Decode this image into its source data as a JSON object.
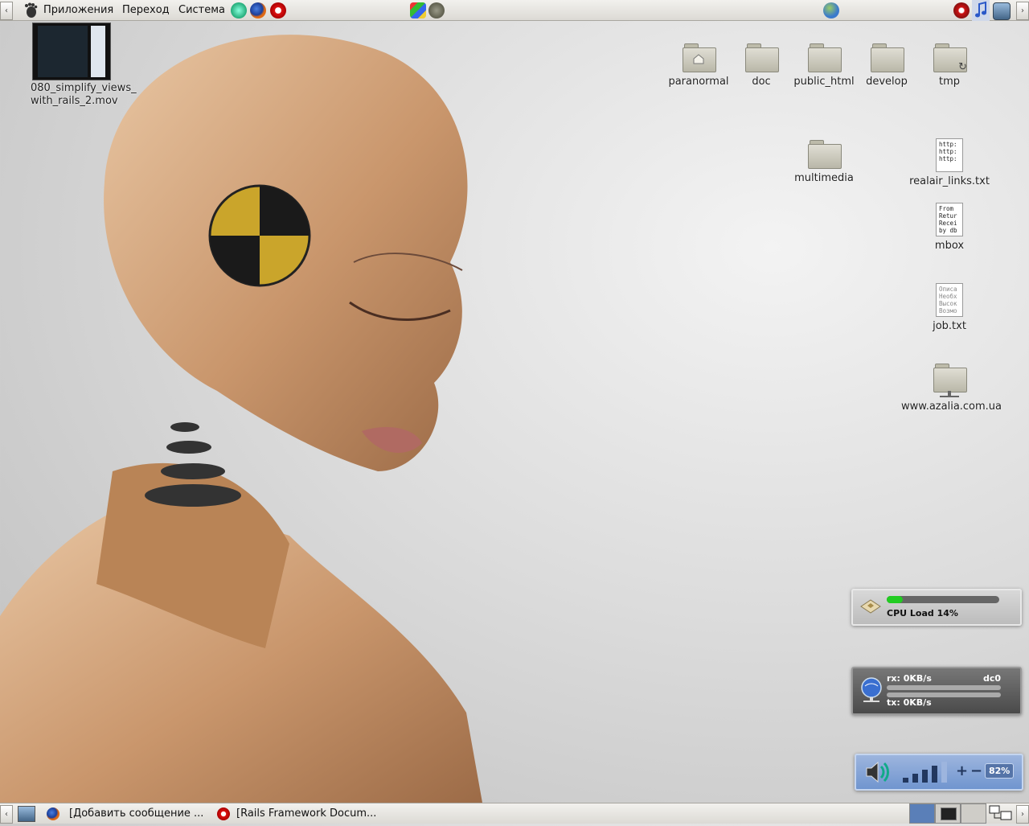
{
  "top_panel": {
    "menus": [
      "Приложения",
      "Переход",
      "Система"
    ]
  },
  "desktop_icons": {
    "video": "080_simplify_views_\nwith_rails_2.mov",
    "folders": [
      "paranormal",
      "doc",
      "public_html",
      "develop",
      "tmp",
      "multimedia",
      "www.azalia.com.ua"
    ],
    "realair_links": {
      "label": "realair_links.txt",
      "preview": [
        "http:",
        "http:",
        "http:"
      ]
    },
    "mbox": {
      "label": "mbox",
      "preview": [
        "From",
        "Retur",
        "Recei",
        "by db"
      ]
    },
    "job": {
      "label": "job.txt",
      "preview": [
        "Описа",
        "Необх",
        "Высок",
        "Возмо"
      ]
    }
  },
  "widgets": {
    "cpu": {
      "label": "CPU Load 14%",
      "load_percent": 14
    },
    "network": {
      "rx": "rx: 0KB/s",
      "tx": "tx: 0KB/s",
      "interface": "dc0"
    },
    "volume": {
      "value": "82%",
      "level_percent": 82,
      "plus": "+",
      "minus": "−"
    }
  },
  "bottom_panel": {
    "tasks": [
      "[Добавить сообщение ...",
      "[Rails Framework Docum..."
    ]
  },
  "colors": {
    "panel": "#dcdad5",
    "cpu_bar_fill": "#22cc22",
    "volume_bg": "#7fa0d0",
    "workspace_active": "#5a7fb8"
  }
}
